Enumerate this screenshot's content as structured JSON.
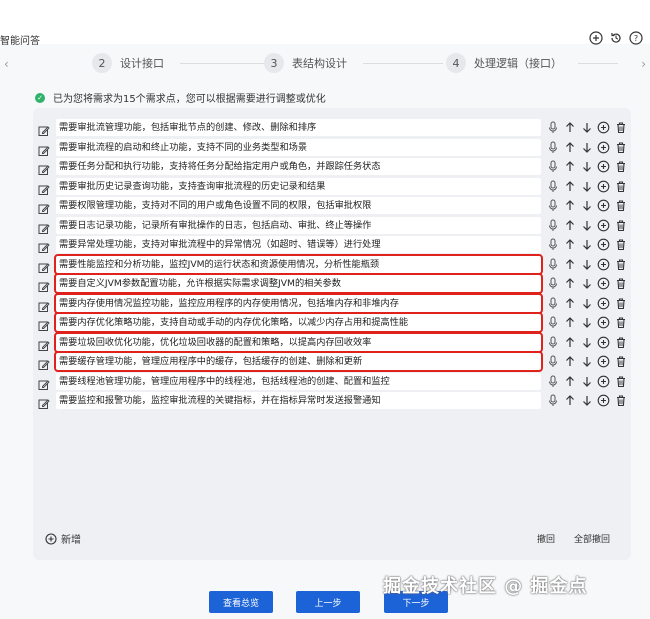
{
  "app": {
    "title": "智能问答"
  },
  "steps": [
    {
      "num": "2",
      "label": "设计接口"
    },
    {
      "num": "3",
      "label": "表结构设计"
    },
    {
      "num": "4",
      "label": "处理逻辑（接口）"
    }
  ],
  "notice": "已为您将需求为15个需求点，您可以根据需要进行调整或优化",
  "requirements": [
    {
      "text": "需要审批流管理功能，包括审批节点的创建、修改、删除和排序",
      "highlighted": false
    },
    {
      "text": "需要审批流程的启动和终止功能，支持不同的业务类型和场景",
      "highlighted": false
    },
    {
      "text": "需要任务分配和执行功能，支持将任务分配给指定用户或角色，并跟踪任务状态",
      "highlighted": false
    },
    {
      "text": "需要审批历史记录查询功能，支持查询审批流程的历史记录和结果",
      "highlighted": false
    },
    {
      "text": "需要权限管理功能，支持对不同的用户或角色设置不同的权限，包括审批权限",
      "highlighted": false
    },
    {
      "text": "需要日志记录功能，记录所有审批操作的日志，包括启动、审批、终止等操作",
      "highlighted": false
    },
    {
      "text": "需要异常处理功能，支持对审批流程中的异常情况（如超时、错误等）进行处理",
      "highlighted": false
    },
    {
      "text": "需要性能监控和分析功能，监控JVM的运行状态和资源使用情况，分析性能瓶颈",
      "highlighted": true
    },
    {
      "text": "需要自定义JVM参数配置功能，允许根据实际需求调整JVM的相关参数",
      "highlighted": true
    },
    {
      "text": "需要内存使用情况监控功能，监控应用程序的内存使用情况，包括堆内存和非堆内存",
      "highlighted": true
    },
    {
      "text": "需要内存优化策略功能，支持自动或手动的内存优化策略，以减少内存占用和提高性能",
      "highlighted": true
    },
    {
      "text": "需要垃圾回收优化功能，优化垃圾回收器的配置和策略，以提高内存回收效率",
      "highlighted": true
    },
    {
      "text": "需要缓存管理功能，管理应用程序中的缓存，包括缓存的创建、删除和更新",
      "highlighted": true
    },
    {
      "text": "需要线程池管理功能，管理应用程序中的线程池，包括线程池的创建、配置和监控",
      "highlighted": false
    },
    {
      "text": "需要监控和报警功能，监控审批流程的关键指标，并在指标异常时发送报警通知",
      "highlighted": false
    }
  ],
  "panel": {
    "add_label": "新增",
    "undo_label": "撤回",
    "undo_all_label": "全部撤回"
  },
  "footer": {
    "view_summary": "查看总览",
    "prev": "上一步",
    "next": "下一步"
  },
  "watermark": "掘金技术社区 @ 掘金点",
  "colors": {
    "primary": "#1d63d8",
    "highlight_border": "#e0221c",
    "success": "#2fb36b"
  }
}
